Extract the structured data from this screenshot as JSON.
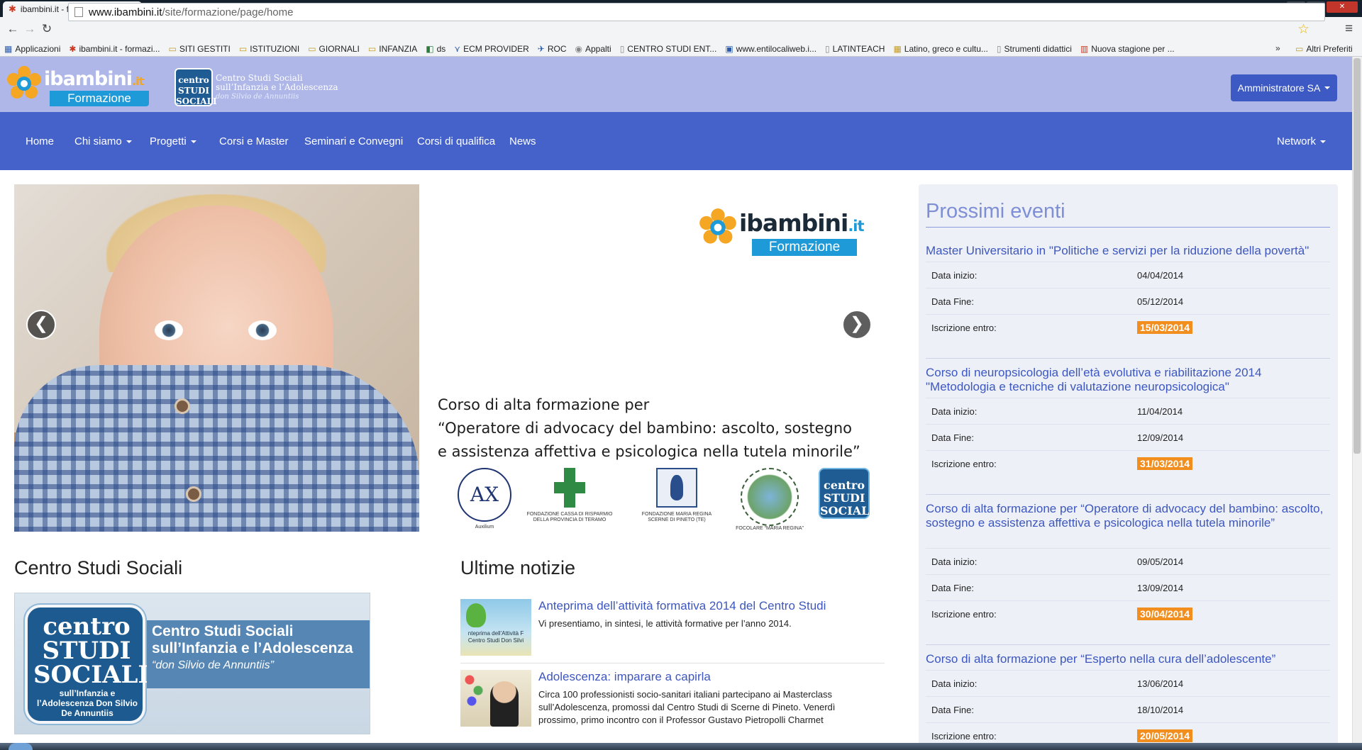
{
  "browser": {
    "tab_title": "ibambini.it - formazione",
    "url_host": "www.ibambini.it",
    "url_path": "/site/formazione/page/home",
    "bookmarks": [
      "Applicazioni",
      "ibambini.it - formazi...",
      "SITI GESTITI",
      "ISTITUZIONI",
      "GIORNALI",
      "INFANZIA",
      "ds",
      "ECM PROVIDER",
      "ROC",
      "Appalti",
      "CENTRO STUDI ENT...",
      "www.entilocaliweb.i...",
      "LATINTEACH",
      "Latino, greco e cultu...",
      "Strumenti didattici",
      "Nuova stagione per ..."
    ],
    "bookmarks_more": "»",
    "bookmarks_other": "Altri Preferiti"
  },
  "header": {
    "logo_name": "ibambini",
    "logo_tld": ".it",
    "logo_sub": "Formazione",
    "centro_emblem": "centro STUDI SOCIALI",
    "centro_line1": "Centro Studi Sociali",
    "centro_line2": "sull’Infanzia e l’Adolescenza",
    "centro_line3": "don Silvio de Annuntiis",
    "admin_label": "Amministratore SA"
  },
  "nav": {
    "home": "Home",
    "chi_siamo": "Chi siamo",
    "progetti": "Progetti",
    "corsi_master": "Corsi e Master",
    "seminari": "Seminari e Convegni",
    "corsi_qualifica": "Corsi di qualifica",
    "news": "News",
    "network": "Network"
  },
  "carousel": {
    "slide_logo_name": "ibambini",
    "slide_logo_tld": ".it",
    "slide_logo_sub": "Formazione",
    "partner1": "Auxilium",
    "partner2": "FONDAZIONE CASSA DI RISPARMIO DELLA PROVINCIA DI TERAMO",
    "partner3": "FONDAZIONE MARIA REGINA SCERNE DI PINETO (TE)",
    "partner4": "FOCOLARE “MARIA REGINA” Ente Morale",
    "partner5": "centro STUDI SOCIALI",
    "slide_line1": "Corso di alta formazione per",
    "slide_line2": "“Operatore di advocacy del bambino: ascolto, sostegno",
    "slide_line3": "e assistenza affettiva e psicologica nella tutela minorile”",
    "prev": "❮",
    "next": "❯"
  },
  "sidebar": {
    "title": "Prossimi eventi",
    "label_start": "Data inizio:",
    "label_end": "Data Fine:",
    "label_reg": "Iscrizione entro:",
    "events": [
      {
        "title": "Master Universitario in \"Politiche e servizi per la riduzione della povertà\"",
        "start": "04/04/2014",
        "end": "05/12/2014",
        "reg": "15/03/2014"
      },
      {
        "title": "Corso di neuropsicologia dell’età evolutiva e riabilitazione 2014 \"Metodologia e tecniche di valutazione neuropsicologica\"",
        "start": "11/04/2014",
        "end": "12/09/2014",
        "reg": "31/03/2014"
      },
      {
        "title": "Corso di alta formazione per “Operatore di advocacy del bambino: ascolto, sostegno e assistenza affettiva e psicologica nella tutela minorile”",
        "start": "09/05/2014",
        "end": "13/09/2014",
        "reg": "30/04/2014"
      },
      {
        "title": "Corso di alta formazione per “Esperto nella cura dell’adolescente”",
        "start": "13/06/2014",
        "end": "18/10/2014",
        "reg": "20/05/2014"
      }
    ]
  },
  "centro": {
    "section_title": "Centro Studi Sociali",
    "emblem_big": "centro STUDI SOCIALI",
    "emblem_small": "sull’Infanzia e l’Adolescenza Don Silvio De Annuntiis",
    "banner_line1": "Centro Studi Sociali",
    "banner_line2": "sull’Infanzia e l’Adolescenza",
    "banner_line3": "“don Silvio de Annuntiis”"
  },
  "news": {
    "section_title": "Ultime notizie",
    "items": [
      {
        "title": "Anteprima dell’attività formativa 2014 del Centro Studi",
        "desc": "Vi presentiamo, in sintesi, le attività formative per l’anno 2014.",
        "thumb_caption": "nteprima dell'Attività F Centro Studi Don Silvi"
      },
      {
        "title": "Adolescenza: imparare a capirla",
        "desc": "Circa 100 professionisti socio-sanitari italiani partecipano ai Masterclass sull’Adolescenza, promossi dal Centro Studi di Scerne di Pineto. Venerdì prossimo, primo incontro con il Professor Gustavo Pietropolli Charmet"
      }
    ]
  }
}
